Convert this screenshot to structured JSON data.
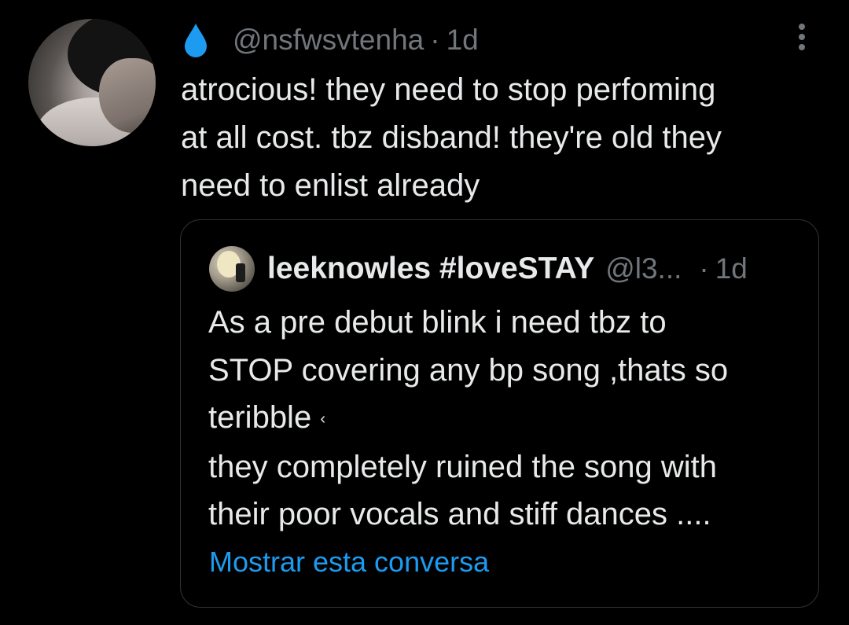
{
  "tweet": {
    "handle": "@nsfwsvtenha",
    "separator": "·",
    "time": "1d",
    "text_lines": [
      "atrocious! they need to stop perfoming",
      "at all cost. tbz disband! they're old they",
      "need to enlist already"
    ],
    "icons": {
      "badge": "water-drop-icon",
      "menu": "more-options-icon"
    }
  },
  "quote": {
    "display_name": "leeknowles #loveSTAY",
    "handle": "@l3...",
    "separator": "·",
    "time": "1d",
    "text_lines": [
      "As a pre debut blink i need tbz to",
      "STOP covering any bp song ,thats so",
      "teribble",
      "they completely ruined the song with",
      "their poor vocals and stiff dances ...."
    ],
    "trailing_glyph": "‹",
    "show_thread_label": "Mostrar esta conversa"
  },
  "colors": {
    "background": "#000000",
    "text": "#e7e9ea",
    "secondary": "#71767b",
    "link": "#1d9bf0",
    "border": "#2f3336",
    "drop": "#1d9bf0"
  }
}
